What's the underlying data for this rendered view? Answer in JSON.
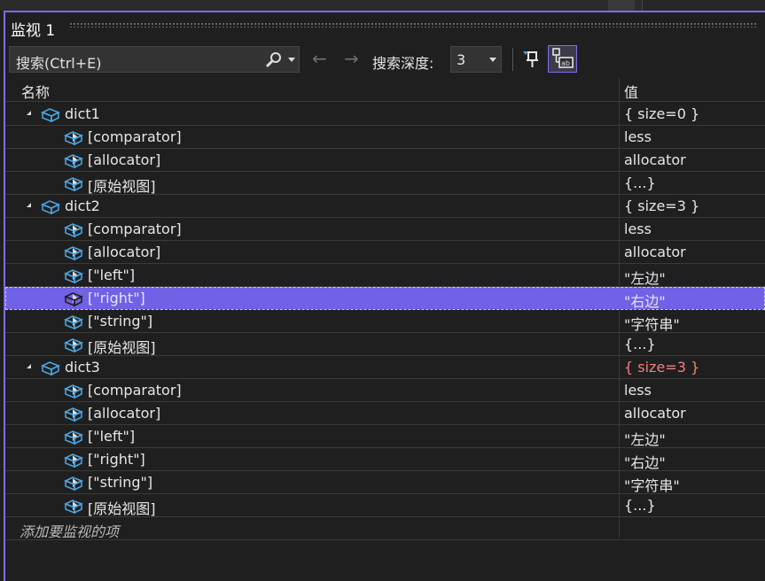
{
  "window": {
    "title": "监视 1"
  },
  "toolbar": {
    "search_placeholder": "搜索(Ctrl+E)",
    "back_arrow": "←",
    "forward_arrow": "→",
    "depth_label": "搜索深度:",
    "depth_value": "3"
  },
  "columns": {
    "name": "名称",
    "value": "值"
  },
  "rows": [
    {
      "name": "dict1",
      "value": "{ size=0 }",
      "level": 0,
      "expanded": true
    },
    {
      "name": "[comparator]",
      "value": "less",
      "level": 1,
      "expanded": false
    },
    {
      "name": "[allocator]",
      "value": "allocator",
      "level": 1,
      "expanded": false
    },
    {
      "name": "[原始视图]",
      "value": "{...}",
      "level": 1,
      "expanded": false
    },
    {
      "name": "dict2",
      "value": "{ size=3 }",
      "level": 0,
      "expanded": true
    },
    {
      "name": "[comparator]",
      "value": "less",
      "level": 1,
      "expanded": false
    },
    {
      "name": "[allocator]",
      "value": "allocator",
      "level": 1,
      "expanded": false
    },
    {
      "name": "[\"left\"]",
      "value": "\"左边\"",
      "level": 1,
      "expanded": false
    },
    {
      "name": "[\"right\"]",
      "value": "\"右边\"",
      "level": 1,
      "expanded": false,
      "selected": true
    },
    {
      "name": "[\"string\"]",
      "value": "\"字符串\"",
      "level": 1,
      "expanded": false
    },
    {
      "name": "[原始视图]",
      "value": "{...}",
      "level": 1,
      "expanded": false
    },
    {
      "name": "dict3",
      "value": "{ size=3 }",
      "level": 0,
      "expanded": true,
      "changed": true
    },
    {
      "name": "[comparator]",
      "value": "less",
      "level": 1,
      "expanded": false
    },
    {
      "name": "[allocator]",
      "value": "allocator",
      "level": 1,
      "expanded": false
    },
    {
      "name": "[\"left\"]",
      "value": "\"左边\"",
      "level": 1,
      "expanded": false
    },
    {
      "name": "[\"right\"]",
      "value": "\"右边\"",
      "level": 1,
      "expanded": false
    },
    {
      "name": "[\"string\"]",
      "value": "\"字符串\"",
      "level": 1,
      "expanded": false
    },
    {
      "name": "[原始视图]",
      "value": "{...}",
      "level": 1,
      "expanded": false
    }
  ],
  "add_item_placeholder": "添加要监视的项",
  "colors": {
    "accent": "#7b6ef0",
    "selection": "#7161e6",
    "changed_value": "#f0807a",
    "icon": "#4aa3df"
  }
}
